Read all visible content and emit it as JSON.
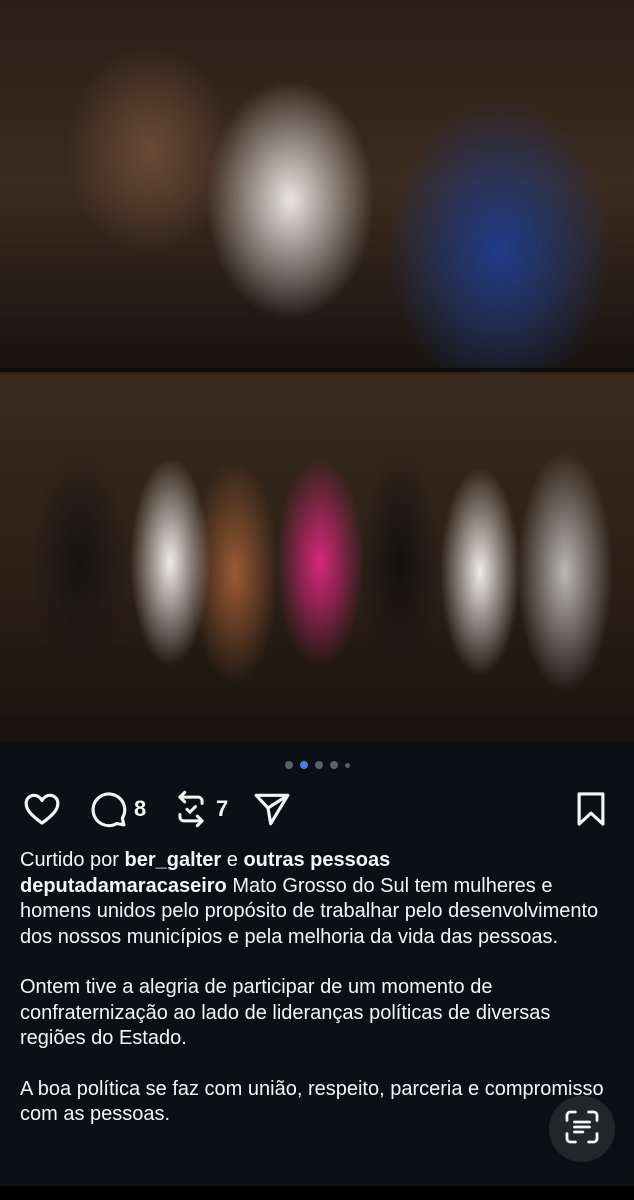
{
  "post": {
    "media": {
      "top_photo_alt": "photo",
      "bottom_photo_alt": "photo",
      "carousel": {
        "count": 5,
        "active_index": 1
      }
    },
    "actions": {
      "comments_count": "8",
      "reposts_count": "7"
    },
    "likes": {
      "prefix": "Curtido por ",
      "user": "ber_galter",
      "middle": " e ",
      "others": "outras pessoas"
    },
    "caption": {
      "username": "deputadamaracaseiro",
      "paragraph1": " Mato Grosso do Sul tem mulheres e homens unidos pelo propósito de trabalhar pelo desenvolvimento dos nossos municípios e pela melhoria da vida das pessoas.",
      "paragraph2": "Ontem tive a alegria de participar de um momento de confraternização ao lado de lideranças políticas de diversas regiões do Estado.",
      "paragraph3": "A boa política se faz com união, respeito, parceria e compromisso com as pessoas."
    }
  },
  "icons": {
    "like": "heart-icon",
    "comment": "comment-bubble-icon",
    "repost": "repost-icon",
    "share": "paper-plane-icon",
    "save": "bookmark-icon",
    "scan": "text-scan-icon"
  },
  "colors": {
    "background": "#0c1014",
    "text": "#f5f5f5",
    "active_dot": "#4a7cf0",
    "inactive_dot": "#5c5f66"
  }
}
